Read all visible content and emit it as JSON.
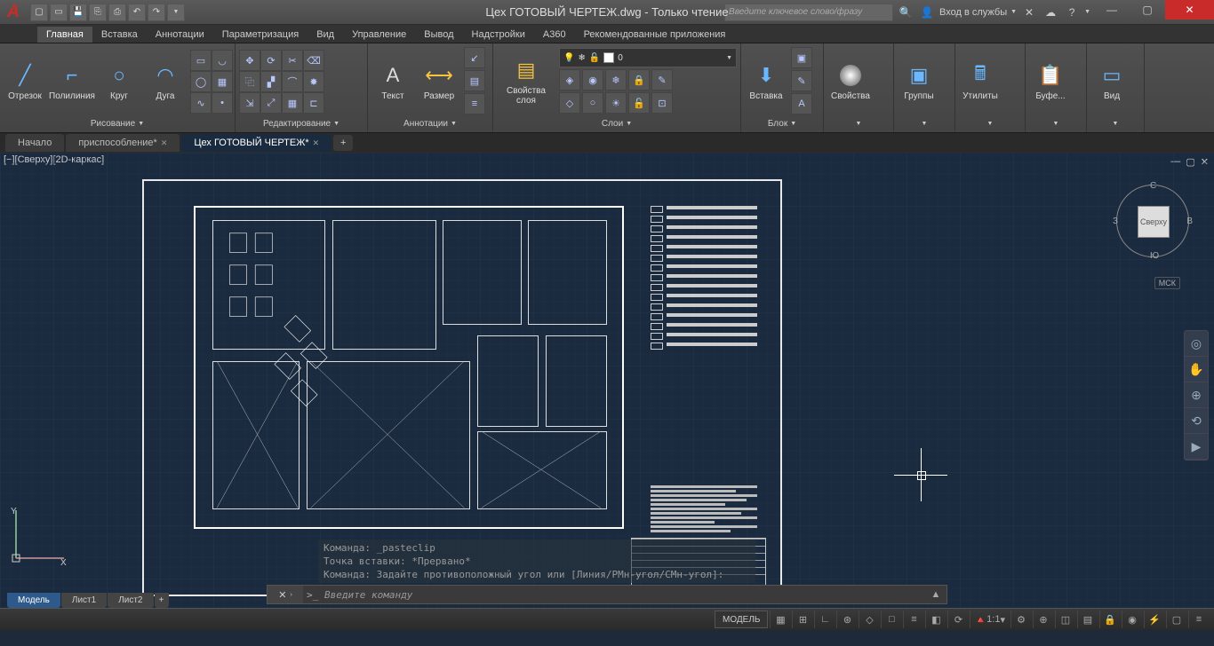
{
  "title": "Цех ГОТОВЫЙ ЧЕРТЕЖ.dwg - Только чтение",
  "search_placeholder": "Введите ключевое слово/фразу",
  "signin": "Вход в службы",
  "ribbon_tabs": [
    "Главная",
    "Вставка",
    "Аннотации",
    "Параметризация",
    "Вид",
    "Управление",
    "Вывод",
    "Надстройки",
    "A360",
    "Рекомендованные приложения"
  ],
  "panels": {
    "draw": {
      "title": "Рисование",
      "line": "Отрезок",
      "pline": "Полилиния",
      "circle": "Круг",
      "arc": "Дуга"
    },
    "modify": {
      "title": "Редактирование"
    },
    "annot": {
      "title": "Аннотации",
      "text": "Текст",
      "dim": "Размер"
    },
    "layers": {
      "title": "Слои",
      "props": "Свойства слоя",
      "current": "0"
    },
    "block": {
      "title": "Блок",
      "insert": "Вставка"
    },
    "props": {
      "title": "Свойства"
    },
    "groups": {
      "title": "Группы"
    },
    "utils": {
      "title": "Утилиты"
    },
    "clip": {
      "title": "Буфе..."
    },
    "view": {
      "title": "Вид"
    }
  },
  "doctabs": {
    "start": "Начало",
    "t1": "приспособление*",
    "t2": "Цех ГОТОВЫЙ ЧЕРТЕЖ*"
  },
  "viewport_label": "[−][Сверху][2D-каркас]",
  "viewcube": {
    "face": "Сверху",
    "n": "С",
    "s": "Ю",
    "e": "В",
    "w": "З",
    "wcs": "МСК"
  },
  "cmd_history": {
    "l1": "Команда: _pasteclip",
    "l2": "Точка вставки: *Прервано*",
    "l3": "Команда: Задайте противоположный угол или [Линия/РМн-угол/СМн-угол]:"
  },
  "cmd_placeholder": "Введите команду",
  "layout_tabs": {
    "model": "Модель",
    "l1": "Лист1",
    "l2": "Лист2"
  },
  "status": {
    "model": "МОДЕЛЬ",
    "scale": "1:1"
  }
}
